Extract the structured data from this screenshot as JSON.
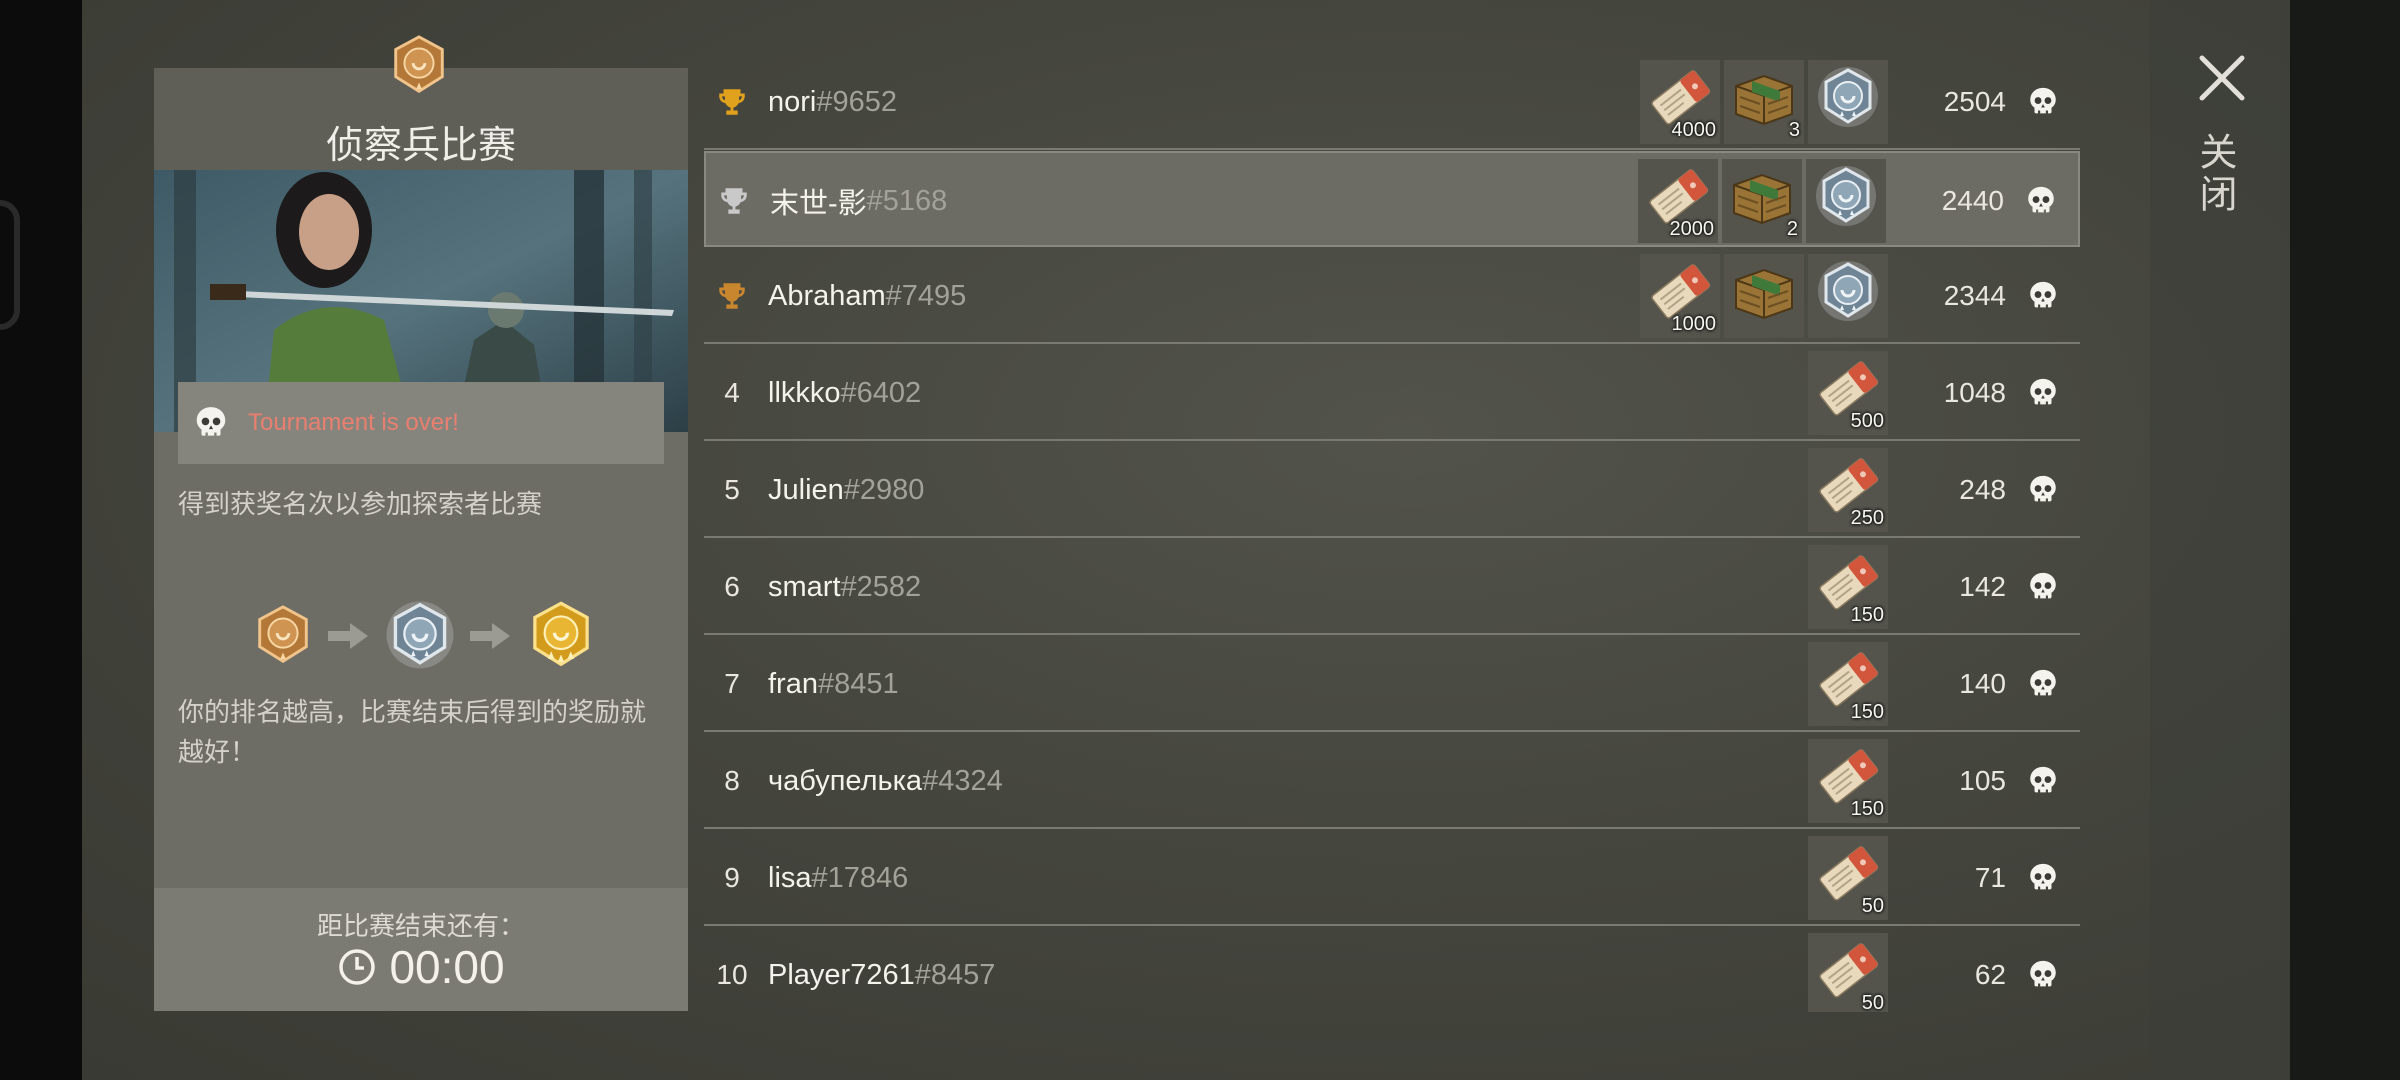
{
  "panel": {
    "title": "侦察兵比赛",
    "status_text": "Tournament is over!",
    "description": "得到获奖名次以参加探索者比赛",
    "reward_note": "你的排名越高，比赛结束后得到的奖励就越好！",
    "countdown_label": "距比赛结束还有：",
    "countdown_value": "00:00"
  },
  "close_label": "关闭",
  "leaderboard": [
    {
      "rank": "1",
      "trophy": "gold-trophy",
      "name": "nori",
      "tag": "#9652",
      "score": "2504",
      "rewards": [
        {
          "item": "ticket-icon",
          "count": "4000"
        },
        {
          "item": "crate-icon",
          "count": "3"
        },
        {
          "item": "silver-medal-icon",
          "count": ""
        }
      ]
    },
    {
      "rank": "2",
      "trophy": "silver-trophy",
      "name": "末世-影",
      "tag": "#5168",
      "score": "2440",
      "rewards": [
        {
          "item": "ticket-icon",
          "count": "2000"
        },
        {
          "item": "crate-icon",
          "count": "2"
        },
        {
          "item": "silver-medal-icon",
          "count": ""
        }
      ]
    },
    {
      "rank": "3",
      "trophy": "bronze-trophy",
      "name": "Abraham",
      "tag": "#7495",
      "score": "2344",
      "rewards": [
        {
          "item": "ticket-icon",
          "count": "1000"
        },
        {
          "item": "crate-icon",
          "count": ""
        },
        {
          "item": "silver-medal-icon",
          "count": ""
        }
      ]
    },
    {
      "rank": "4",
      "trophy": "",
      "name": "llkkko",
      "tag": "#6402",
      "score": "1048",
      "rewards": [
        {
          "item": "ticket-icon",
          "count": "500"
        }
      ]
    },
    {
      "rank": "5",
      "trophy": "",
      "name": "Julien",
      "tag": "#2980",
      "score": "248",
      "rewards": [
        {
          "item": "ticket-icon",
          "count": "250"
        }
      ]
    },
    {
      "rank": "6",
      "trophy": "",
      "name": "smart",
      "tag": "#2582",
      "score": "142",
      "rewards": [
        {
          "item": "ticket-icon",
          "count": "150"
        }
      ]
    },
    {
      "rank": "7",
      "trophy": "",
      "name": "fran",
      "tag": "#8451",
      "score": "140",
      "rewards": [
        {
          "item": "ticket-icon",
          "count": "150"
        }
      ]
    },
    {
      "rank": "8",
      "trophy": "",
      "name": "чабупелька",
      "tag": "#4324",
      "score": "105",
      "rewards": [
        {
          "item": "ticket-icon",
          "count": "150"
        }
      ]
    },
    {
      "rank": "9",
      "trophy": "",
      "name": "lisa",
      "tag": "#17846",
      "score": "71",
      "rewards": [
        {
          "item": "ticket-icon",
          "count": "50"
        }
      ]
    },
    {
      "rank": "10",
      "trophy": "",
      "name": "Player7261",
      "tag": "#8457",
      "score": "62",
      "rewards": [
        {
          "item": "ticket-icon",
          "count": "50"
        }
      ]
    }
  ],
  "colors": {
    "gold": "#e0a21c",
    "silver": "#c9c9c9",
    "bronze": "#c8862e",
    "status_red": "#ea7f70",
    "highlight_row": "#6d6c64"
  }
}
